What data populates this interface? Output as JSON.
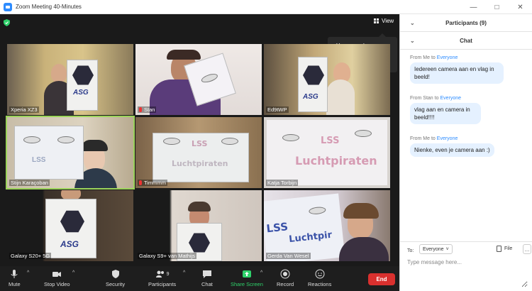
{
  "window": {
    "title": "Zoom Meeting 40-Minutes"
  },
  "meeting": {
    "view_label": "View",
    "tooltip_text": "You can release your video order here",
    "tiles": [
      {
        "name": "Xperia XZ3",
        "muted": false
      },
      {
        "name": "Stan",
        "muted": true
      },
      {
        "name": "Ed9tWP",
        "muted": false
      },
      {
        "name": "Stijn Karaçoban",
        "muted": false
      },
      {
        "name": "Timmmm",
        "muted": true
      },
      {
        "name": "Katja Torbijn",
        "muted": false
      },
      {
        "name": "Galaxy S20+ 5G",
        "muted": false
      },
      {
        "name": "Galaxy S9+ van Mathijs",
        "muted": false
      },
      {
        "name": "Gerda Van Wesel",
        "muted": false
      }
    ],
    "signs": {
      "lss": "LSS",
      "luchtpiraten": "Luchtpiraten",
      "asg": "ASG"
    }
  },
  "toolbar": {
    "mute": "Mute",
    "stop_video": "Stop Video",
    "security": "Security",
    "participants": "Participants",
    "participants_count": "9",
    "chat": "Chat",
    "share_screen": "Share Screen",
    "record": "Record",
    "reactions": "Reactions",
    "end": "End"
  },
  "panel": {
    "participants_header": "Participants (9)",
    "chat_header": "Chat",
    "messages": [
      {
        "from_prefix": "From",
        "from": "Me",
        "to_word": "to",
        "to": "Everyone",
        "text": "Iedereen camera aan en vlag in beeld!"
      },
      {
        "from_prefix": "From",
        "from": "Stan",
        "to_word": "to",
        "to": "Everyone",
        "text": "vlag aan en camera in beeld!!!!"
      },
      {
        "from_prefix": "From",
        "from": "Me",
        "to_word": "to",
        "to": "Everyone",
        "text": "Nienke, even je camera aan :)"
      }
    ],
    "to_label": "To:",
    "to_value": "Everyone",
    "file_label": "File",
    "more_label": "...",
    "input_placeholder": "Type message here..."
  },
  "colors": {
    "accent": "#2d8cff",
    "end": "#d9302e",
    "active_speaker": "#9bd35a",
    "share": "#2fd26b"
  }
}
